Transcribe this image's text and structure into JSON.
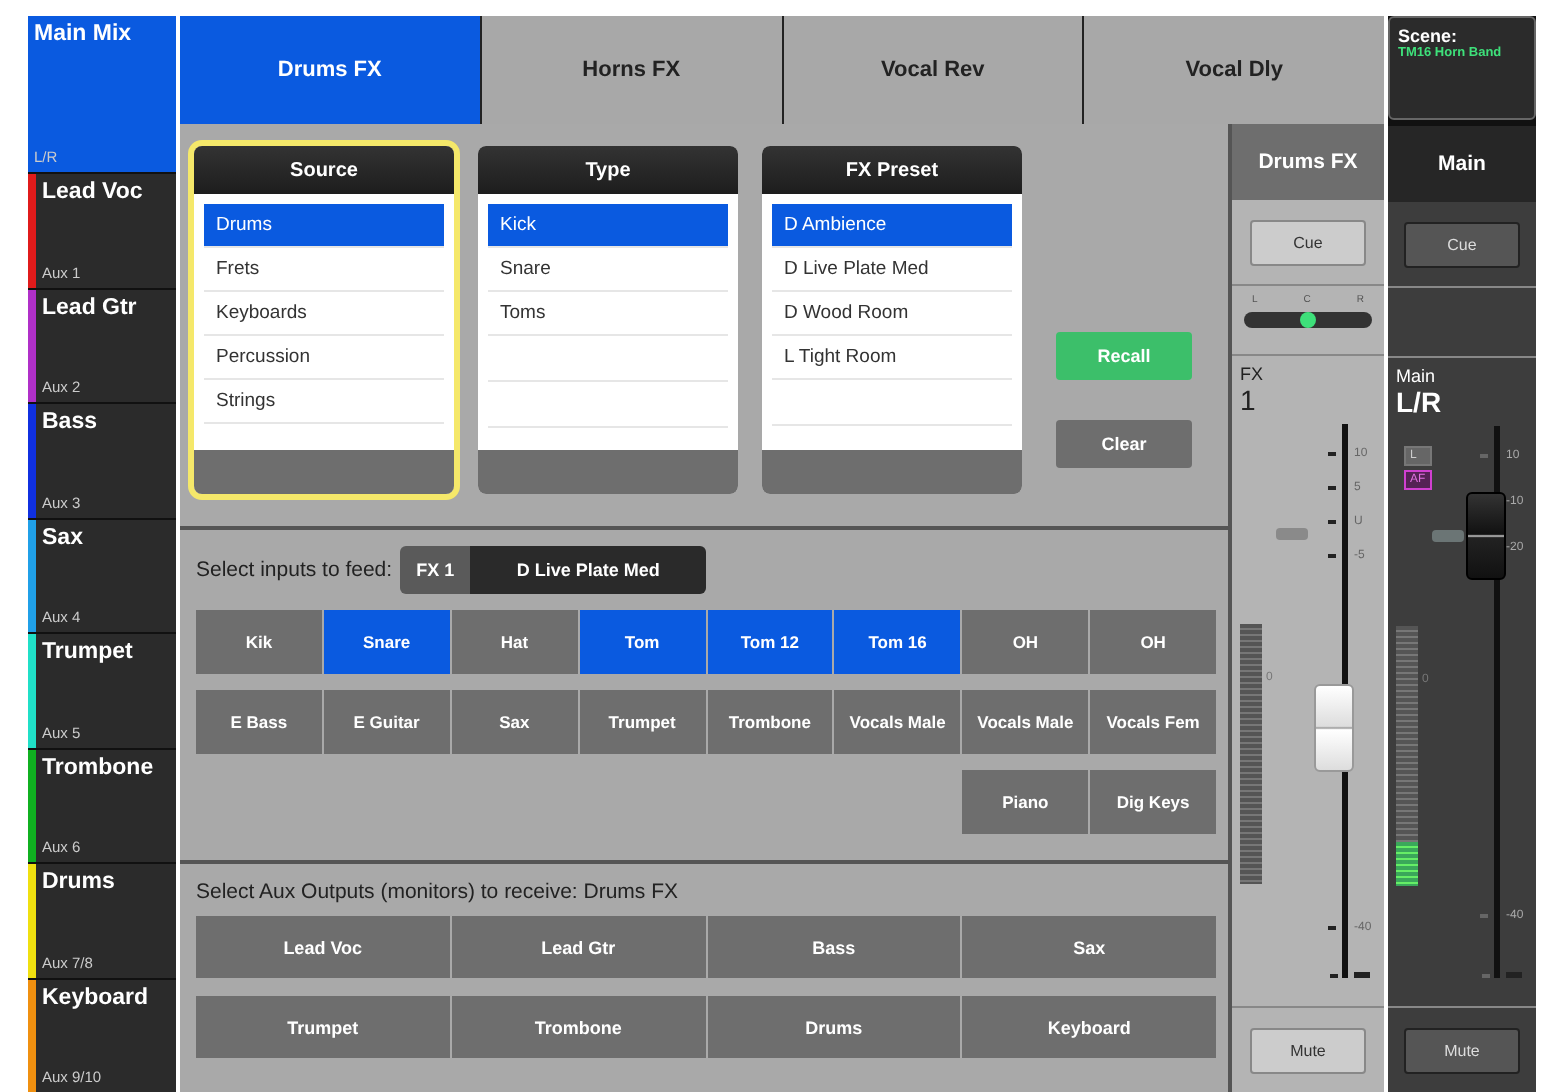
{
  "sidebar": {
    "main": {
      "name": "Main Mix",
      "bus": "L/R",
      "selected": true
    },
    "mixes": [
      {
        "name": "Lead Voc",
        "bus": "Aux 1",
        "color": "#e01b1b",
        "selected": false
      },
      {
        "name": "Lead Gtr",
        "bus": "Aux 2",
        "color": "#b030c8",
        "selected": false
      },
      {
        "name": "Bass",
        "bus": "Aux 3",
        "color": "#1030e0",
        "selected": false
      },
      {
        "name": "Sax",
        "bus": "Aux 4",
        "color": "#20a0e8",
        "selected": false
      },
      {
        "name": "Trumpet",
        "bus": "Aux 5",
        "color": "#20e0c8",
        "selected": false
      },
      {
        "name": "Trombone",
        "bus": "Aux 6",
        "color": "#10b020",
        "selected": false
      },
      {
        "name": "Drums",
        "bus": "Aux 7/8",
        "color": "#f0e010",
        "selected": false
      },
      {
        "name": "Keyboard",
        "bus": "Aux 9/10",
        "color": "#f09010",
        "selected": false
      }
    ]
  },
  "tabs": [
    {
      "label": "Drums FX",
      "selected": true
    },
    {
      "label": "Horns FX",
      "selected": false
    },
    {
      "label": "Vocal Rev",
      "selected": false
    },
    {
      "label": "Vocal Dly",
      "selected": false
    }
  ],
  "lists": [
    {
      "title": "Source",
      "focused": true,
      "items": [
        {
          "label": "Drums",
          "selected": true
        },
        {
          "label": "Frets",
          "selected": false
        },
        {
          "label": "Keyboards",
          "selected": false
        },
        {
          "label": "Percussion",
          "selected": false
        },
        {
          "label": "Strings",
          "selected": false
        }
      ]
    },
    {
      "title": "Type",
      "focused": false,
      "items": [
        {
          "label": "Kick",
          "selected": true
        },
        {
          "label": "Snare",
          "selected": false
        },
        {
          "label": "Toms",
          "selected": false
        }
      ]
    },
    {
      "title": "FX Preset",
      "focused": false,
      "items": [
        {
          "label": "D Ambience",
          "selected": true
        },
        {
          "label": "D Live Plate Med",
          "selected": false
        },
        {
          "label": "D Wood Room",
          "selected": false
        },
        {
          "label": "L Tight Room",
          "selected": false
        }
      ]
    }
  ],
  "actions": [
    {
      "label": "Recall",
      "kind": "recall"
    },
    {
      "label": "Clear",
      "kind": "clear"
    }
  ],
  "feed": {
    "label": "Select inputs to feed:",
    "fx": "FX 1",
    "preset": "D Live Plate Med",
    "rows": [
      [
        {
          "label": "Kik",
          "selected": false
        },
        {
          "label": "Snare",
          "selected": true
        },
        {
          "label": "Hat",
          "selected": false
        },
        {
          "label": "Tom",
          "selected": true
        },
        {
          "label": "Tom 12",
          "selected": true
        },
        {
          "label": "Tom 16",
          "selected": true
        },
        {
          "label": "OH",
          "selected": false
        },
        {
          "label": "OH",
          "selected": false
        }
      ],
      [
        {
          "label": "E Bass",
          "selected": false
        },
        {
          "label": "E Guitar",
          "selected": false
        },
        {
          "label": "Sax",
          "selected": false
        },
        {
          "label": "Trumpet",
          "selected": false
        },
        {
          "label": "Trombone",
          "selected": false
        },
        {
          "label": "Vocals Male",
          "selected": false
        },
        {
          "label": "Vocals Male",
          "selected": false
        },
        {
          "label": "Vocals Fem",
          "selected": false
        }
      ],
      [
        "",
        "",
        "",
        "",
        "",
        "",
        {
          "label": "Piano",
          "selected": false
        },
        {
          "label": "Dig Keys",
          "selected": false
        }
      ]
    ]
  },
  "aux": {
    "label": "Select Aux Outputs (monitors) to receive:  Drums FX",
    "outputs": [
      {
        "label": "Lead Voc",
        "selected": false
      },
      {
        "label": "Lead Gtr",
        "selected": false
      },
      {
        "label": "Bass",
        "selected": false
      },
      {
        "label": "Sax",
        "selected": false
      },
      {
        "label": "Trumpet",
        "selected": false
      },
      {
        "label": "Trombone",
        "selected": false
      },
      {
        "label": "Drums",
        "selected": false
      },
      {
        "label": "Keyboard",
        "selected": false
      }
    ]
  },
  "scene": {
    "label": "Scene:",
    "name": "TM16 Horn Band"
  },
  "strips": [
    {
      "kind": "light",
      "title": "Drums FX",
      "cue": "Cue",
      "pan": {
        "labels": [
          "L",
          "C",
          "R"
        ],
        "level": 0.5
      },
      "type": "FX",
      "number": "1",
      "scale": [
        "10",
        "5",
        "U",
        "-5",
        "-40"
      ],
      "meter_label": "0",
      "fader": {
        "level": 0.45
      },
      "mute": "Mute"
    },
    {
      "kind": "dark",
      "title": "Main",
      "cue": "Cue",
      "type": "Main",
      "number": "L/R",
      "badges": [
        {
          "label": "L",
          "kind": "plain"
        },
        {
          "label": "AF",
          "kind": "purple"
        }
      ],
      "scale": [
        "10",
        "-10",
        "-20",
        "-40"
      ],
      "meter_label": "0",
      "meter": {
        "level": 0.17
      },
      "fader": {
        "level": 0.8
      },
      "mute": "Mute"
    }
  ]
}
